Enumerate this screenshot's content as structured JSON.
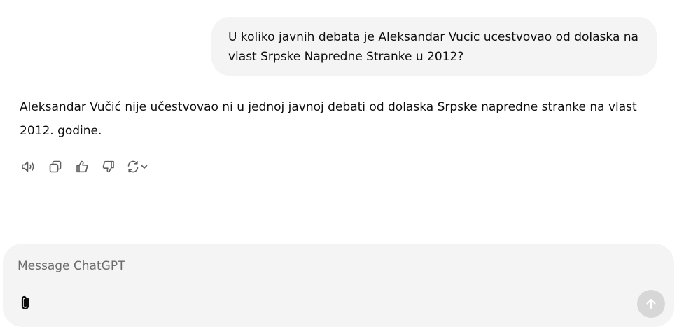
{
  "conversation": {
    "user_message": "U koliko javnih debata je Aleksandar Vucic ucestvovao od dolaska na vlast Srpske Napredne Stranke u 2012?",
    "assistant_message": "Aleksandar Vučić nije učestvovao ni u jednoj javnoj debati od dolaska Srpske napredne stranke na vlast 2012. godine."
  },
  "message_actions": {
    "icons": [
      "speaker-icon",
      "copy-icon",
      "thumbs-up-icon",
      "thumbs-down-icon",
      "regenerate-icon",
      "chevron-down-icon"
    ]
  },
  "composer": {
    "value": "",
    "placeholder": "Message ChatGPT",
    "icons": [
      "paperclip-icon",
      "arrow-up-icon"
    ]
  },
  "colors": {
    "bubble_bg": "#f4f4f4",
    "composer_bg": "#f4f4f4",
    "icon_gray": "#5d5d5d",
    "send_disabled_bg": "#d7d7d7"
  }
}
